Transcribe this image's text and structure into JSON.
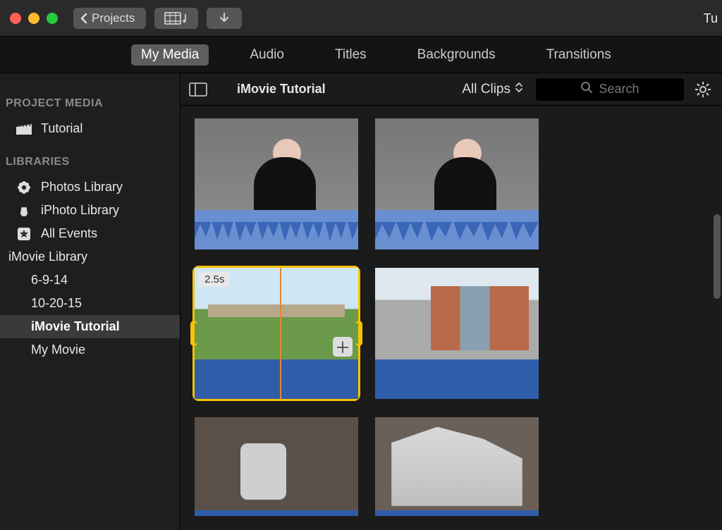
{
  "titlebar": {
    "projects_label": "Projects",
    "right_text": "Tu"
  },
  "tabs": {
    "my_media": "My Media",
    "audio": "Audio",
    "titles": "Titles",
    "backgrounds": "Backgrounds",
    "transitions": "Transitions"
  },
  "sidebar": {
    "project_media_header": "PROJECT MEDIA",
    "project_item": "Tutorial",
    "libraries_header": "LIBRARIES",
    "photos_library": "Photos Library",
    "iphoto_library": "iPhoto Library",
    "all_events": "All Events",
    "imovie_library": "iMovie Library",
    "children": {
      "c0": "6-9-14",
      "c1": "10-20-15",
      "c2": "iMovie Tutorial",
      "c3": "My Movie"
    }
  },
  "content_toolbar": {
    "title": "iMovie Tutorial",
    "filter_label": "All Clips",
    "search_placeholder": "Search"
  },
  "clips": {
    "selected_duration": "2.5s"
  }
}
